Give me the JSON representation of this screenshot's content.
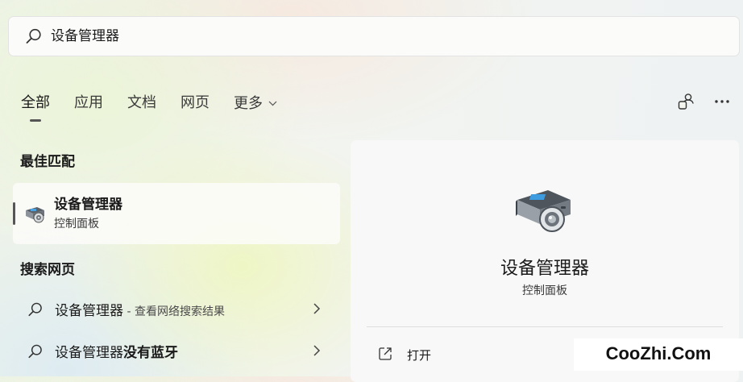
{
  "search": {
    "value": "设备管理器",
    "icon": "search-icon"
  },
  "tabs": [
    {
      "label": "全部",
      "active": true
    },
    {
      "label": "应用",
      "active": false
    },
    {
      "label": "文档",
      "active": false
    },
    {
      "label": "网页",
      "active": false
    },
    {
      "label": "更多",
      "active": false,
      "has_dropdown": true
    }
  ],
  "top_right_icons": [
    "account-switch-icon",
    "more-options-icon"
  ],
  "best_match": {
    "section_title": "最佳匹配",
    "name": "设备管理器",
    "subtitle": "控制面板",
    "icon": "device-manager-icon"
  },
  "web_search": {
    "section_title": "搜索网页",
    "items": [
      {
        "query": "设备管理器",
        "suffix": " - 查看网络搜索结果"
      },
      {
        "query": "设备管理器",
        "bold_suffix": "没有蓝牙"
      }
    ]
  },
  "preview": {
    "title": "设备管理器",
    "subtitle": "控制面板",
    "actions": [
      {
        "label": "打开",
        "icon": "open-external-icon"
      }
    ]
  },
  "watermark": "CooZhi.Com"
}
